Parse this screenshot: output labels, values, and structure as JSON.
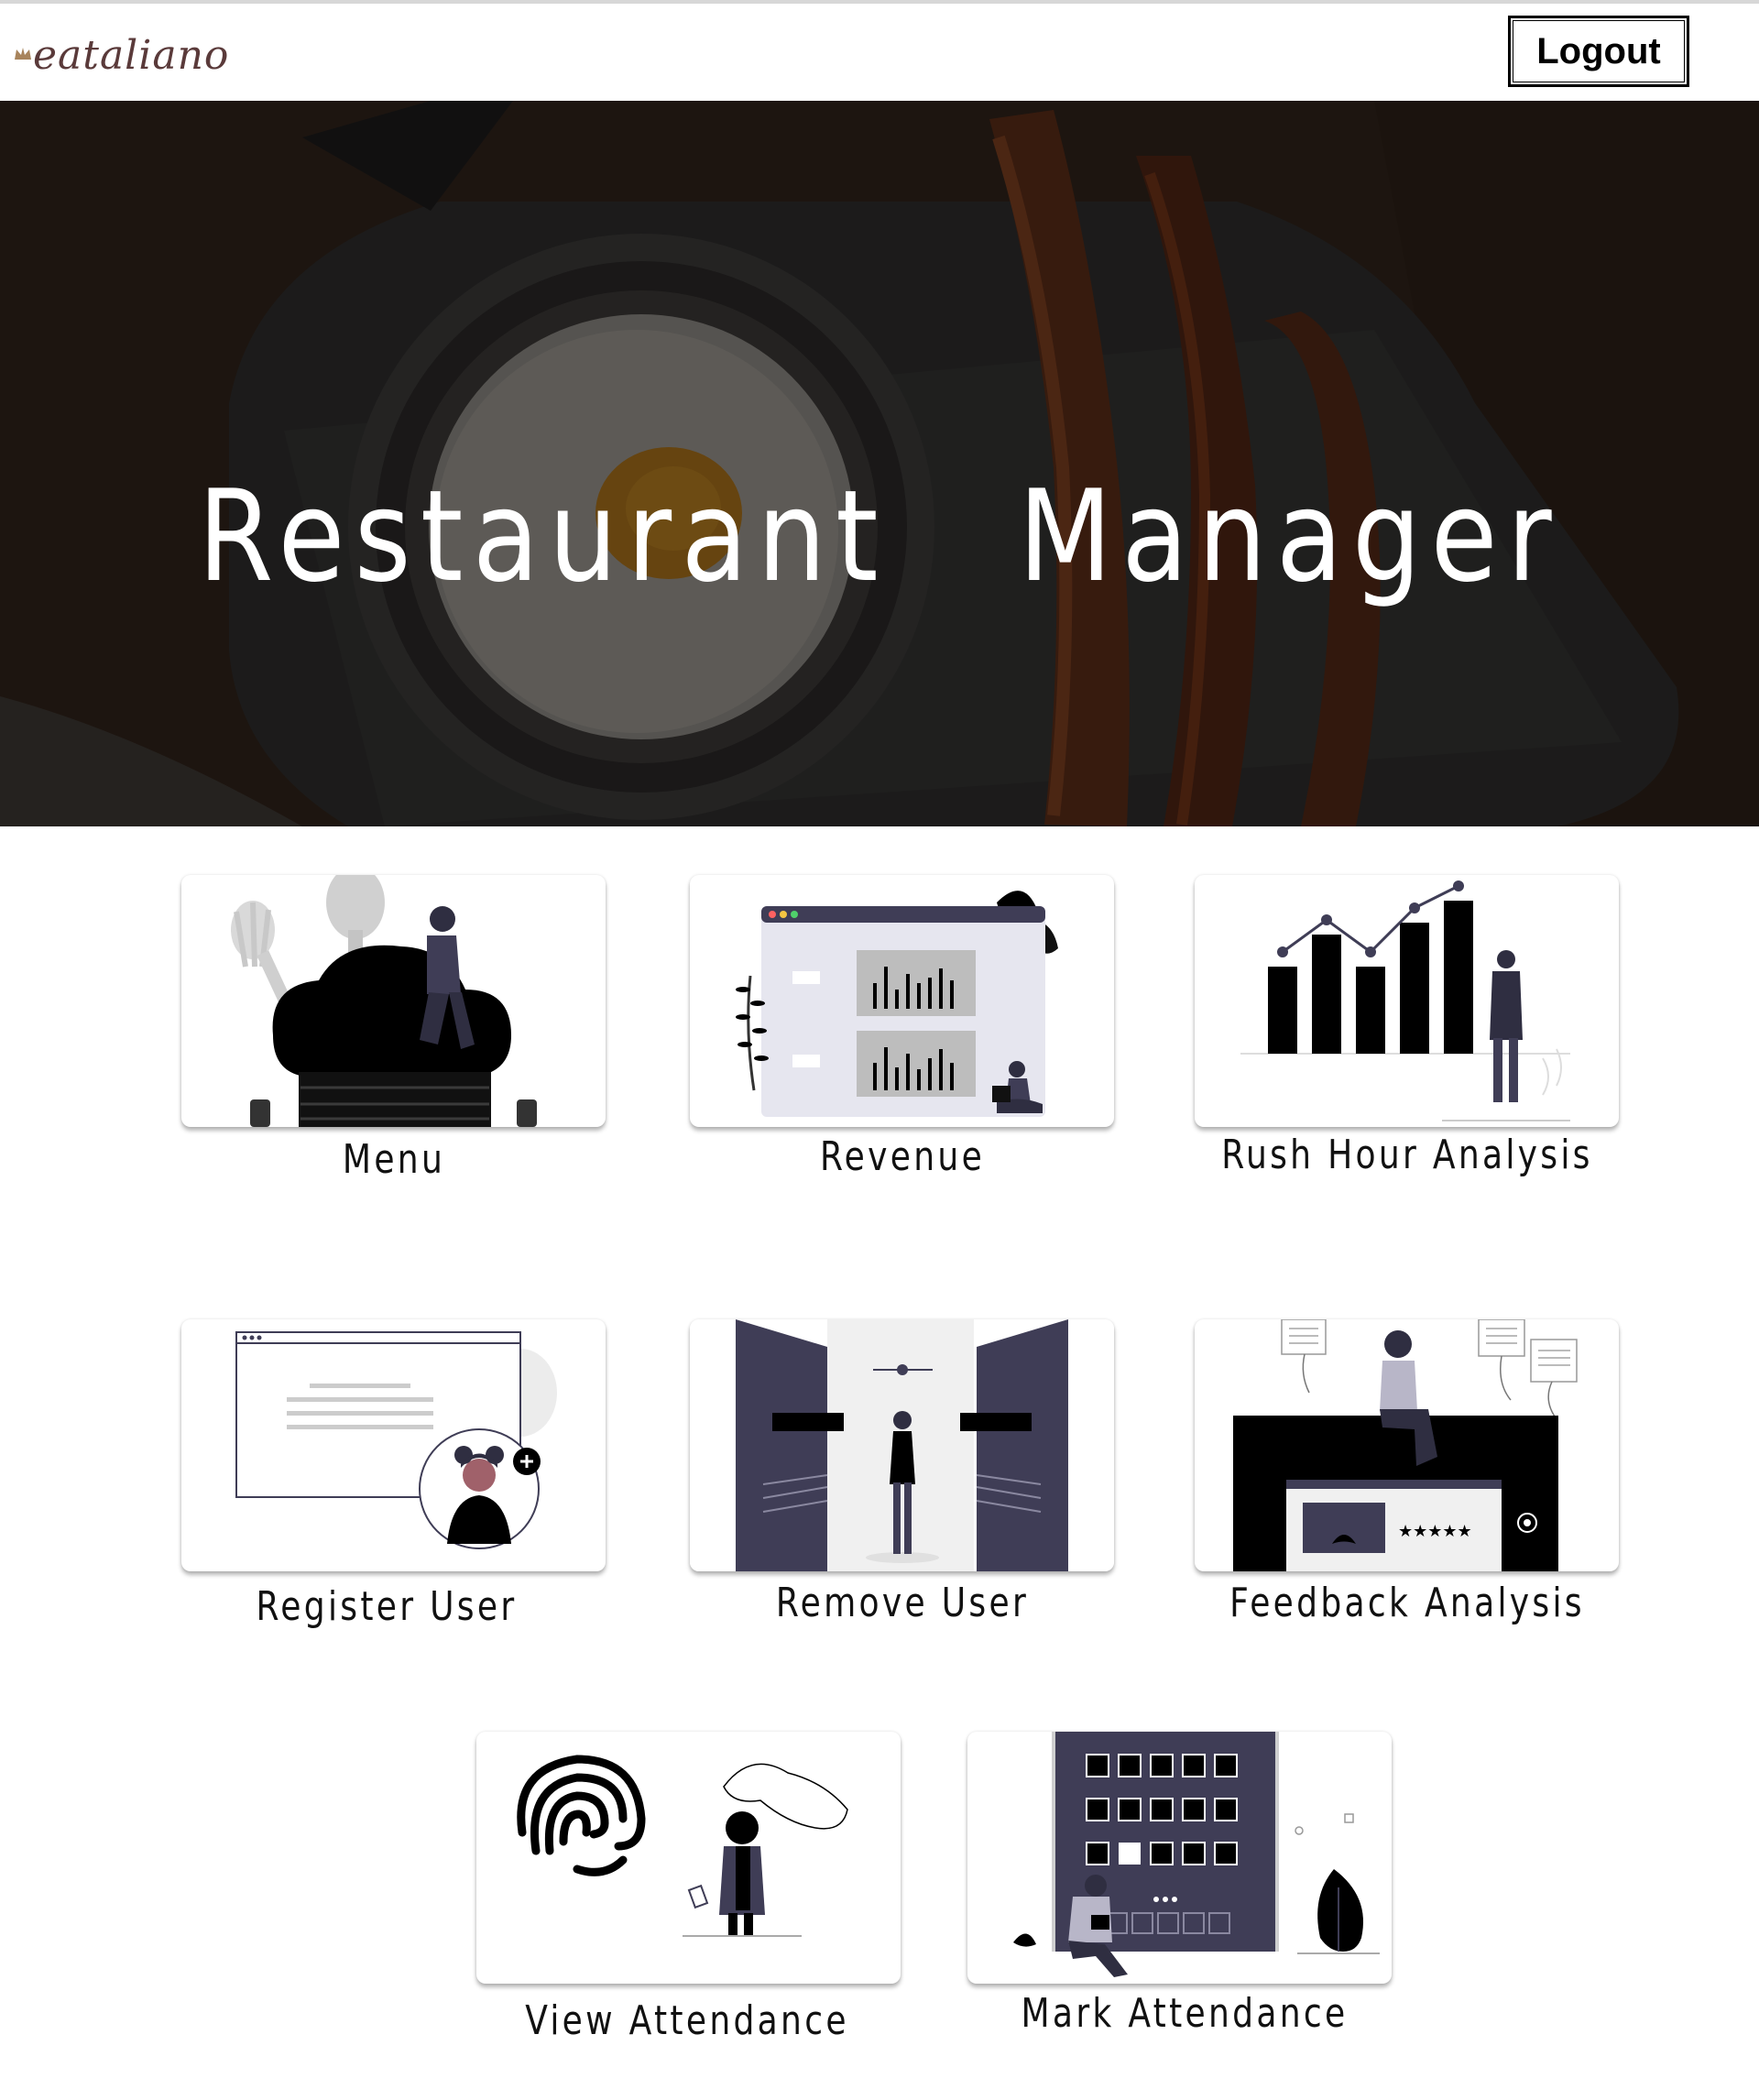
{
  "brand": {
    "name": "eataliano"
  },
  "nav": {
    "logout_label": "Logout"
  },
  "hero": {
    "title": "Restaurant Manager"
  },
  "cards": [
    {
      "label": "Menu",
      "icon": "chef-hat-illustration"
    },
    {
      "label": "Revenue",
      "icon": "revenue-dashboard-illustration"
    },
    {
      "label": "Rush Hour Analysis",
      "icon": "bar-chart-illustration"
    },
    {
      "label": "Register User",
      "icon": "add-user-illustration"
    },
    {
      "label": "Remove User",
      "icon": "doorway-illustration"
    },
    {
      "label": "Feedback Analysis",
      "icon": "rating-illustration"
    },
    {
      "label": "View Attendance",
      "icon": "fingerprint-illustration"
    },
    {
      "label": "Mark Attendance",
      "icon": "building-illustration"
    }
  ],
  "colors": {
    "accent_dark": "#3f3d56",
    "brand": "#5a3a3a"
  }
}
